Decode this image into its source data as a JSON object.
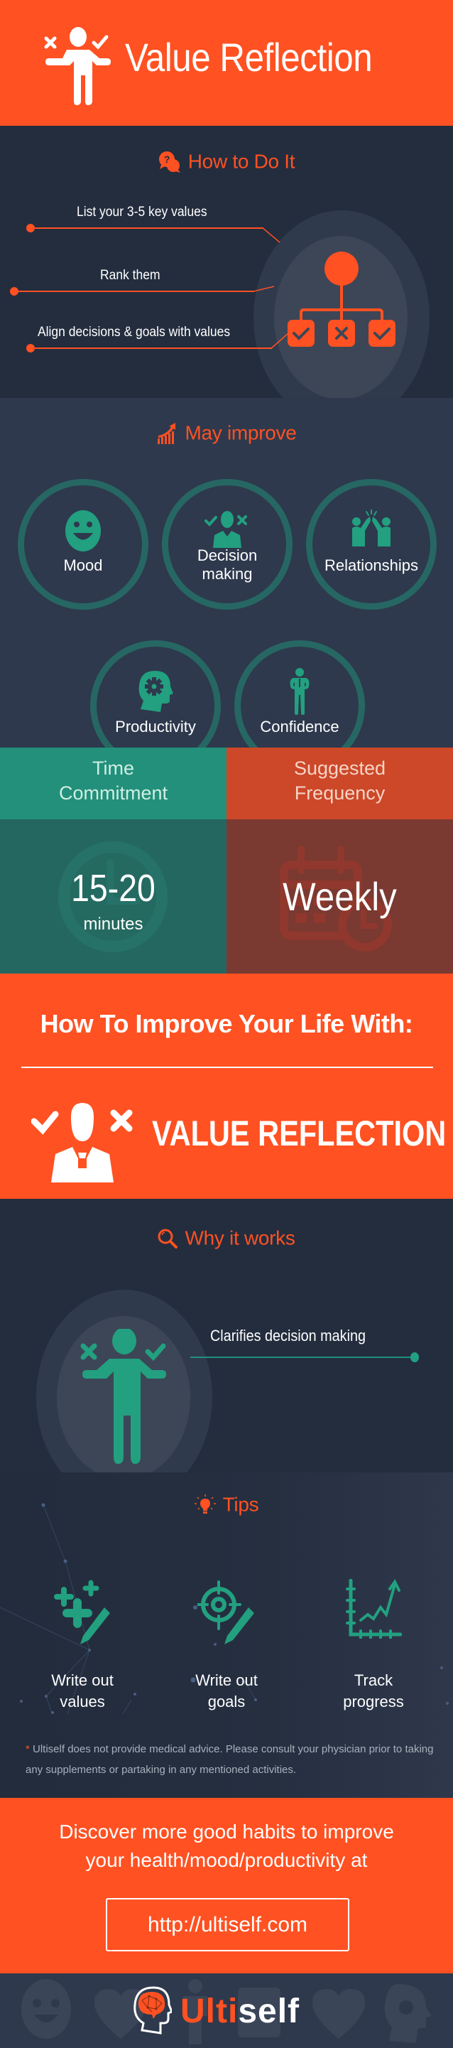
{
  "header": {
    "title": "Value Reflection",
    "icon": "person-weighing-choices-icon"
  },
  "how_to": {
    "title": "How to Do It",
    "icon": "question-chat-icon",
    "steps": [
      {
        "label": "List your 3-5 key values"
      },
      {
        "label": "Rank them"
      },
      {
        "label": "Align decisions & goals with values"
      }
    ],
    "illustration": "hierarchy-check-cross-icon"
  },
  "may_improve": {
    "title": "May improve",
    "icon": "growth-chart-icon",
    "items": [
      {
        "label": "Mood",
        "icon": "smiley-icon"
      },
      {
        "label": "Decision making",
        "label_lines": [
          "Decision",
          "making"
        ],
        "icon": "decision-person-icon"
      },
      {
        "label": "Relationships",
        "icon": "high-five-icon"
      },
      {
        "label": "Productivity",
        "icon": "head-gear-icon"
      },
      {
        "label": "Confidence",
        "icon": "confident-person-icon"
      }
    ]
  },
  "time_commitment": {
    "label_line1": "Time",
    "label_line2": "Commitment",
    "value": "15-20",
    "unit": "minutes",
    "icon": "clock-icon"
  },
  "suggested_frequency": {
    "label_line1": "Suggested",
    "label_line2": "Frequency",
    "value": "Weekly",
    "icon": "calendar-clock-icon"
  },
  "improve_life": {
    "heading": "How To Improve Your Life With:",
    "title": "VALUE REFLECTION",
    "icon": "decision-person-icon"
  },
  "why_it_works": {
    "title": "Why it works",
    "icon": "magnifier-icon",
    "reasons": [
      {
        "label": "Clarifies decision making"
      }
    ],
    "illustration": "person-weighing-choices-icon"
  },
  "tips": {
    "title": "Tips",
    "icon": "lightbulb-icon",
    "items": [
      {
        "line1": "Write out",
        "line2": "values",
        "icon": "plus-pencil-icon"
      },
      {
        "line1": "Write out",
        "line2": "goals",
        "icon": "target-pencil-icon"
      },
      {
        "line1": "Track",
        "line2": "progress",
        "icon": "progress-chart-icon"
      }
    ],
    "disclaimer_star": "*",
    "disclaimer": "Ultiself does not provide medical advice. Please consult your physician prior to taking any supplements or partaking in any mentioned activities."
  },
  "cta": {
    "line1": "Discover more good habits to improve",
    "line2": "your health/mood/productivity at",
    "link": "http://ultiself.com"
  },
  "footer": {
    "brand_part1": "Ulti",
    "brand_part2": "self",
    "logo_icon": "brain-head-icon"
  },
  "colors": {
    "accent_orange": "#ff5122",
    "accent_teal": "#22a080",
    "dark_navy": "#232d3e",
    "slate": "#2e394d"
  }
}
